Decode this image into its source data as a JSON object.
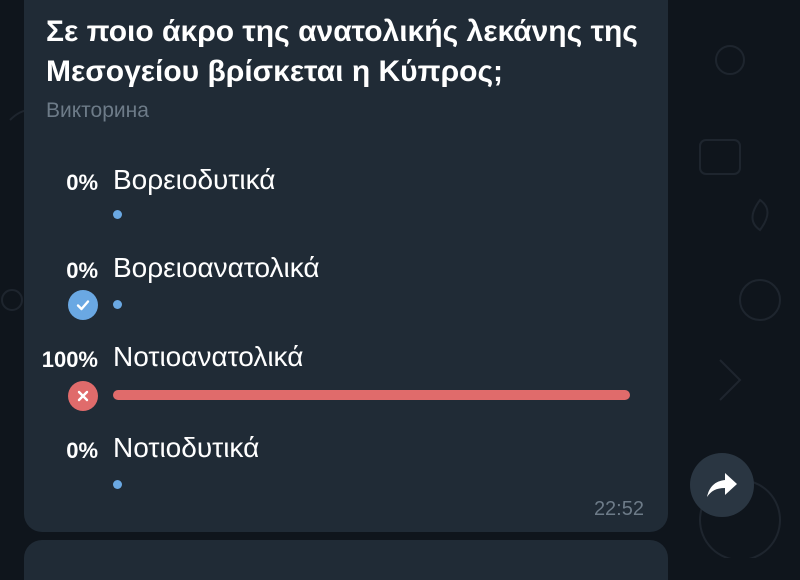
{
  "poll": {
    "question": "Σε ποιο άκρο της ανατολικής λεκάνης της Μεσογείου βρίσκεται η Κύπρος;",
    "type_label": "Викторина",
    "time": "22:52",
    "options": [
      {
        "percent": "0%",
        "label": "Βορειοδυτικά",
        "fraction": 0.0
      },
      {
        "percent": "0%",
        "label": "Βορειοανατολικά",
        "fraction": 0.0
      },
      {
        "percent": "100%",
        "label": "Νοτιοανατολικά",
        "fraction": 1.0
      },
      {
        "percent": "0%",
        "label": "Νοτιοδυτικά",
        "fraction": 0.0
      }
    ],
    "correct_option_index": 1,
    "chosen_wrong_option_index": 2
  },
  "colors": {
    "bubble": "#202b36",
    "accent_blue": "#6aa8e3",
    "wrong_red": "#e06b6b",
    "muted_text": "#6d7b88"
  },
  "icons": {
    "correct": "check-circle-icon",
    "wrong": "x-circle-icon",
    "share": "share-arrow-icon"
  }
}
